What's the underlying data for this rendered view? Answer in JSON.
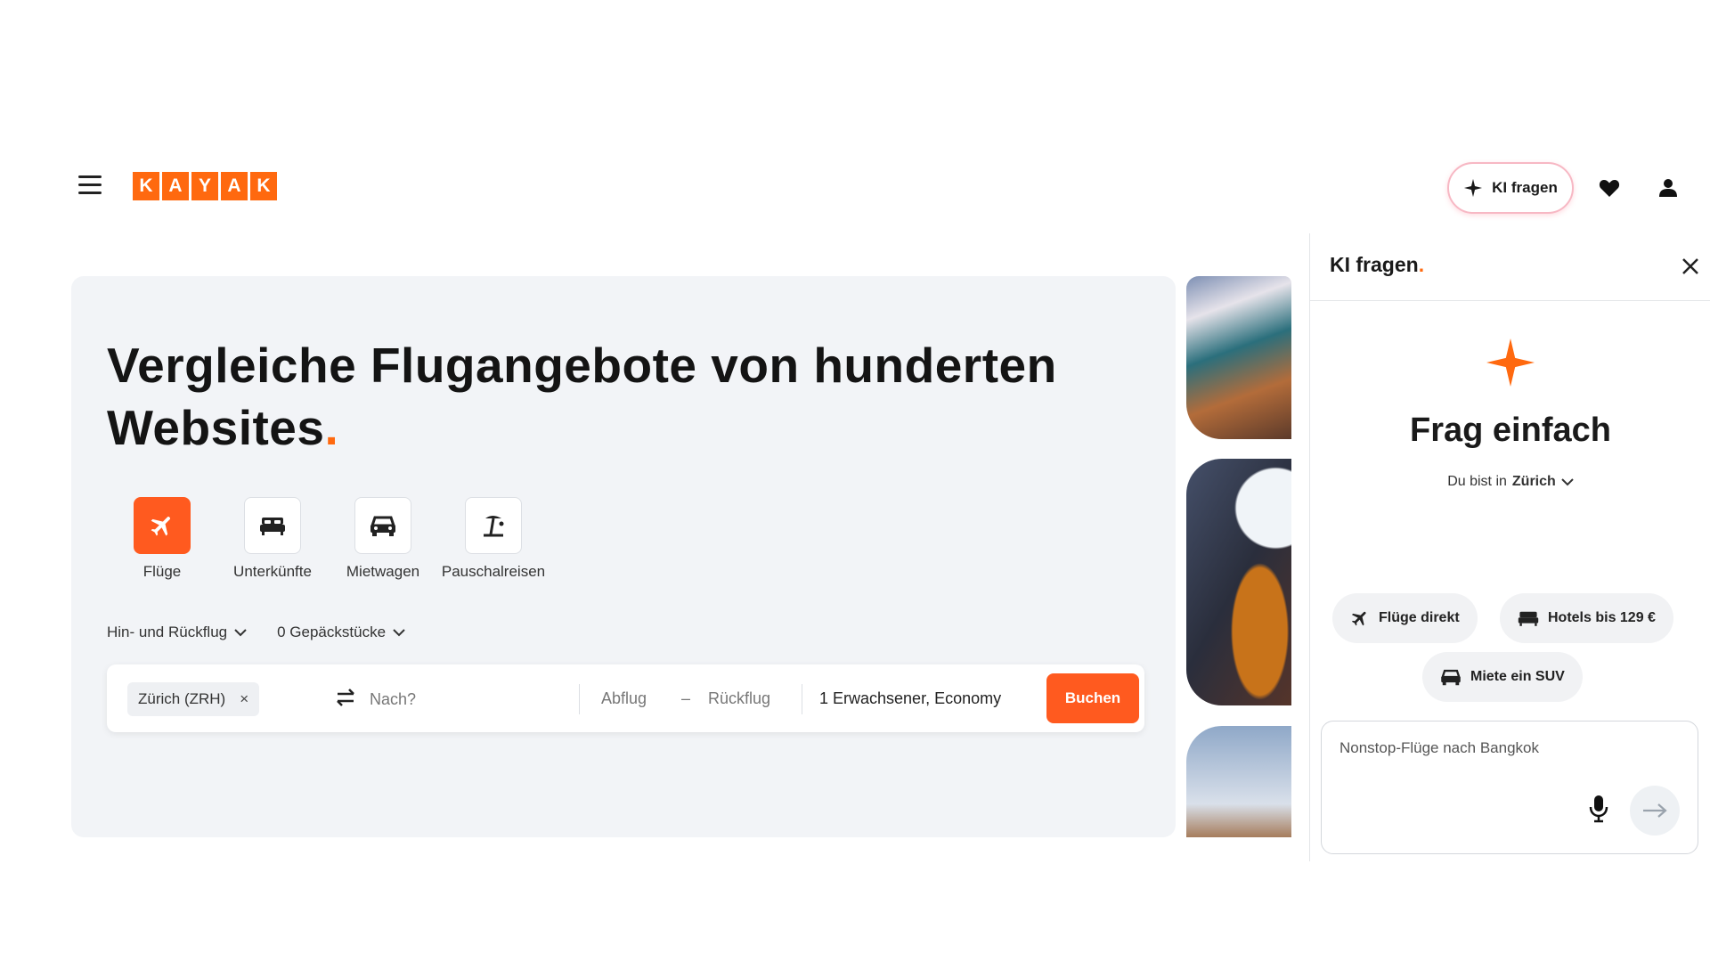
{
  "header": {
    "logo_letters": [
      "K",
      "A",
      "Y",
      "A",
      "K"
    ],
    "ki_button_label": "KI fragen",
    "brand_color": "#ff690f"
  },
  "hero": {
    "title": "Vergleiche Flugangebote von hunderten Websites",
    "title_dot": ".",
    "verticals": [
      {
        "label": "Flüge",
        "icon": "plane-icon",
        "active": true
      },
      {
        "label": "Unterkünfte",
        "icon": "bed-icon",
        "active": false
      },
      {
        "label": "Mietwagen",
        "icon": "car-icon",
        "active": false
      },
      {
        "label": "Pauschalreisen",
        "icon": "beach-umbrella-icon",
        "active": false
      }
    ],
    "trip_type": "Hin- und Rückflug",
    "baggage": "0 Gepäckstücke"
  },
  "search": {
    "origin": "Zürich (ZRH)",
    "origin_remove": "×",
    "destination_placeholder": "Nach?",
    "departure": "Abflug",
    "dash": "–",
    "return": "Rückflug",
    "passengers": "1 Erwachsener, Economy",
    "submit_label": "Buchen",
    "accent": "#ff5a1f"
  },
  "ai_panel": {
    "title": "KI fragen",
    "title_dot": ".",
    "heading": "Frag einfach",
    "location_prefix": "Du bist in",
    "location": "Zürich",
    "suggestions": [
      {
        "label": "Flüge direkt",
        "icon": "plane-icon"
      },
      {
        "label": "Hotels bis 129 €",
        "icon": "bed-icon"
      },
      {
        "label": "Miete ein SUV",
        "icon": "car-icon"
      }
    ],
    "prompt_placeholder": "Nonstop-Flüge nach Bangkok"
  }
}
